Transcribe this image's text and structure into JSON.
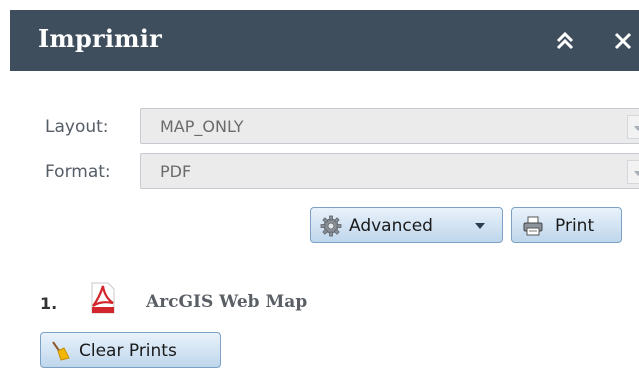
{
  "header": {
    "title": "Imprimir",
    "collapse_icon": "double-chevron-up-icon",
    "close_icon": "close-icon"
  },
  "form": {
    "layout": {
      "label": "Layout:",
      "value": "MAP_ONLY"
    },
    "format": {
      "label": "Format:",
      "value": "PDF"
    }
  },
  "buttons": {
    "advanced_label": "Advanced",
    "advanced_icon": "gear-icon",
    "print_label": "Print",
    "print_icon": "printer-icon"
  },
  "results": {
    "items": [
      {
        "number": "1.",
        "icon": "pdf-file-icon",
        "title": "ArcGIS Web Map"
      }
    ],
    "clear_label": "Clear Prints",
    "clear_icon": "broom-icon"
  },
  "colors": {
    "header_bg": "#3f4e5c",
    "button_border": "#7da1c4",
    "pdf_red": "#d3252c"
  }
}
